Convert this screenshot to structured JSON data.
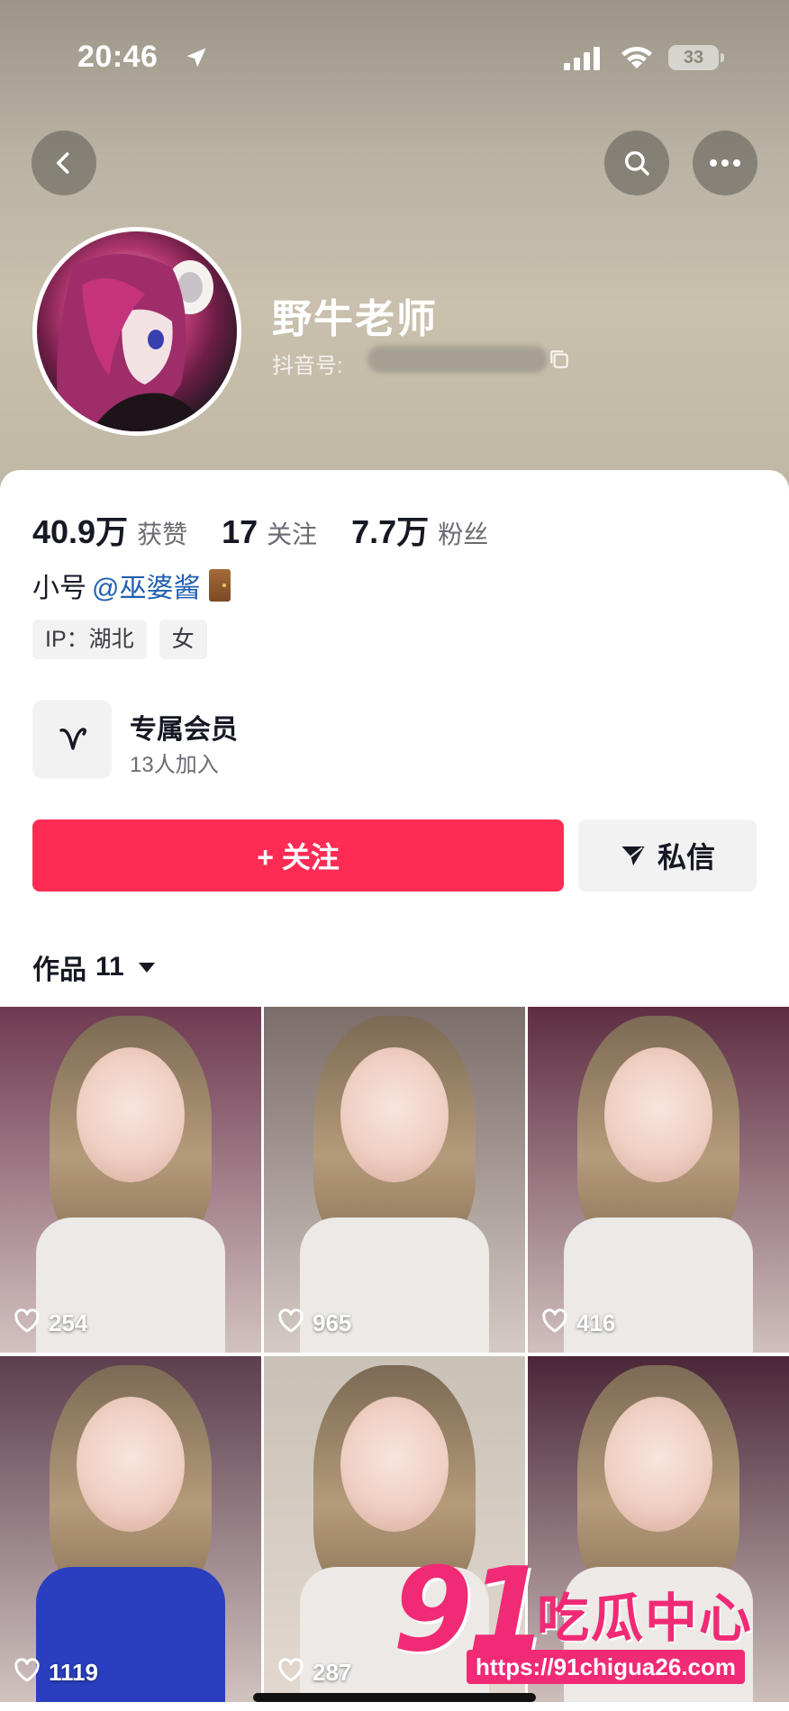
{
  "status_bar": {
    "time": "20:46",
    "battery": "33"
  },
  "profile": {
    "name": "野牛老师",
    "douyin_id_label": "抖音号:"
  },
  "stats": [
    {
      "value": "40.9万",
      "label": "获赞"
    },
    {
      "value": "17",
      "label": "关注"
    },
    {
      "value": "7.7万",
      "label": "粉丝"
    }
  ],
  "alt_account": {
    "prefix": "小号",
    "mention": "@巫婆酱"
  },
  "tags": [
    "IP：湖北",
    "女"
  ],
  "membership": {
    "title": "专属会员",
    "subtitle": "13人加入"
  },
  "actions": {
    "follow": "+ 关注",
    "message": "私信"
  },
  "works_tab": {
    "label": "作品",
    "count": "11"
  },
  "videos": [
    {
      "likes": "254",
      "bg": "#6f3a52"
    },
    {
      "likes": "965",
      "bg": "#7b6d6a"
    },
    {
      "likes": "416",
      "bg": "#5e2d43"
    },
    {
      "likes": "1119",
      "bg": "#5d3e4e"
    },
    {
      "likes": "287",
      "bg": "#c9c1b6"
    },
    {
      "likes": "",
      "bg": "#4a2638"
    }
  ],
  "watermark": {
    "number": "91",
    "text": "吃瓜中心",
    "url": "https://91chigua26.com"
  },
  "colors": {
    "accent": "#fe2c55",
    "link": "#1f5fb0",
    "watermark": "#f12a75"
  }
}
